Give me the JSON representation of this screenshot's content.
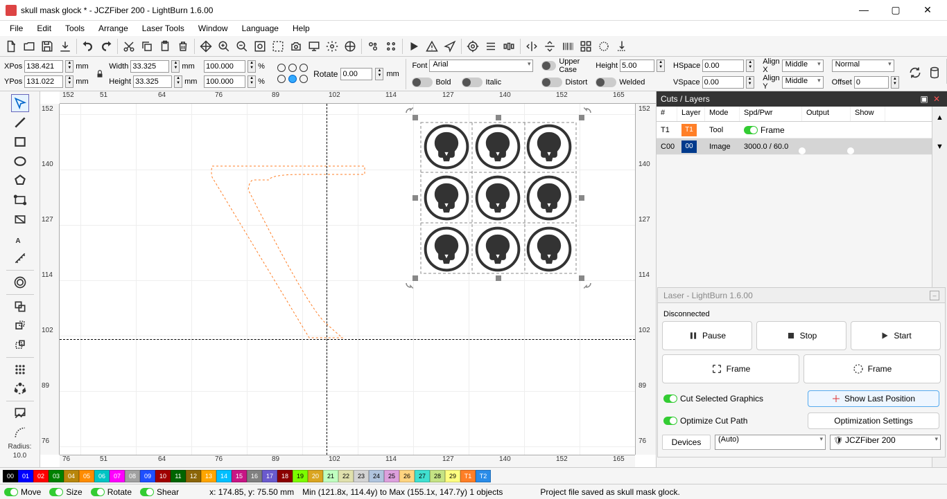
{
  "window": {
    "title": "skull mask glock * - JCZFiber 200 - LightBurn 1.6.00",
    "min": "—",
    "max": "▢",
    "close": "✕"
  },
  "menu": [
    "File",
    "Edit",
    "Tools",
    "Arrange",
    "Laser Tools",
    "Window",
    "Language",
    "Help"
  ],
  "props": {
    "xpos_label": "XPos",
    "xpos": "138.421",
    "ypos_label": "YPos",
    "ypos": "131.022",
    "width_label": "Width",
    "width": "33.325",
    "height_label": "Height",
    "height": "33.325",
    "pct1": "100.000",
    "pct2": "100.000",
    "mm": "mm",
    "pct": "%",
    "rotate_label": "Rotate",
    "rotate": "0.00"
  },
  "text_panel": {
    "font_label": "Font",
    "font": "Arial",
    "height_label": "Height",
    "height": "5.00",
    "hspace_label": "HSpace",
    "hspace": "0.00",
    "vspace_label": "VSpace",
    "vspace": "0.00",
    "alignx_label": "Align X",
    "alignx": "Middle",
    "aligny_label": "Align Y",
    "aligny": "Middle",
    "mode": "Normal",
    "offset_label": "Offset",
    "offset": "0",
    "bold": "Bold",
    "italic": "Italic",
    "upper": "Upper Case",
    "distort": "Distort",
    "welded": "Welded"
  },
  "ruler_top": [
    "152",
    "51",
    "64",
    "76",
    "89",
    "102",
    "114",
    "127",
    "140",
    "152",
    "165",
    "152"
  ],
  "ruler_left": [
    "152",
    "140",
    "127",
    "114",
    "102",
    "89",
    "76"
  ],
  "ruler_right": [
    "152",
    "140",
    "127",
    "114",
    "102",
    "89",
    "76"
  ],
  "radius_label": "Radius:",
  "radius_val": "10.0",
  "cuts": {
    "title": "Cuts / Layers",
    "cols": {
      "num": "#",
      "layer": "Layer",
      "mode": "Mode",
      "spd": "Spd/Pwr",
      "output": "Output",
      "show": "Show"
    },
    "rows": [
      {
        "num": "T1",
        "chip": "T1",
        "chip_bg": "#ff7f27",
        "mode": "Tool",
        "spd": "",
        "extra": "Frame"
      },
      {
        "num": "C00",
        "chip": "00",
        "chip_bg": "#003a8c",
        "mode": "Image",
        "spd": "3000.0 / 60.0",
        "extra": ""
      }
    ]
  },
  "laser": {
    "title": "Laser - LightBurn 1.6.00",
    "status": "Disconnected",
    "pause": "Pause",
    "stop": "Stop",
    "start": "Start",
    "frame": "Frame",
    "cutsel": "Cut Selected Graphics",
    "opt": "Optimize Cut Path",
    "showlast": "Show Last Position",
    "optset": "Optimization Settings",
    "devices": "Devices",
    "auto": "(Auto)",
    "dev": "JCZFiber 200"
  },
  "colorbar": [
    {
      "n": "00",
      "bg": "#000000",
      "fg": "#fff"
    },
    {
      "n": "01",
      "bg": "#0000ff"
    },
    {
      "n": "02",
      "bg": "#ff0000"
    },
    {
      "n": "03",
      "bg": "#008000"
    },
    {
      "n": "04",
      "bg": "#b8860b"
    },
    {
      "n": "05",
      "bg": "#ff8c00"
    },
    {
      "n": "06",
      "bg": "#00c4c4"
    },
    {
      "n": "07",
      "bg": "#ff00ff"
    },
    {
      "n": "08",
      "bg": "#a0a0a0"
    },
    {
      "n": "09",
      "bg": "#1e4fff"
    },
    {
      "n": "10",
      "bg": "#a00000"
    },
    {
      "n": "11",
      "bg": "#006400"
    },
    {
      "n": "12",
      "bg": "#8b6508"
    },
    {
      "n": "13",
      "bg": "#ffa500"
    },
    {
      "n": "14",
      "bg": "#00bfff"
    },
    {
      "n": "15",
      "bg": "#c71585"
    },
    {
      "n": "16",
      "bg": "#808080"
    },
    {
      "n": "17",
      "bg": "#6a5acd"
    },
    {
      "n": "18",
      "bg": "#8b0000"
    },
    {
      "n": "19",
      "bg": "#7cfc00",
      "fg": "#000"
    },
    {
      "n": "20",
      "bg": "#daa520"
    },
    {
      "n": "21",
      "bg": "#c0ffc0",
      "fg": "#000"
    },
    {
      "n": "22",
      "bg": "#e0e0ad",
      "fg": "#000"
    },
    {
      "n": "23",
      "bg": "#d3d3d3",
      "fg": "#000"
    },
    {
      "n": "24",
      "bg": "#b0c4de",
      "fg": "#000"
    },
    {
      "n": "25",
      "bg": "#dda0dd",
      "fg": "#000"
    },
    {
      "n": "26",
      "bg": "#ffd480",
      "fg": "#000"
    },
    {
      "n": "27",
      "bg": "#40e0d0",
      "fg": "#000"
    },
    {
      "n": "28",
      "bg": "#c5e384",
      "fg": "#000"
    },
    {
      "n": "29",
      "bg": "#ffff80",
      "fg": "#000"
    },
    {
      "n": "T1",
      "bg": "#ff7f27"
    },
    {
      "n": "T2",
      "bg": "#2a8ce8"
    }
  ],
  "status": {
    "move": "Move",
    "size": "Size",
    "rotate": "Rotate",
    "shear": "Shear",
    "coord": "x: 174.85, y: 75.50 mm",
    "range": "Min (121.8x, 114.4y) to Max (155.1x, 147.7y)  1 objects",
    "msg": "Project file saved as skull mask glock."
  }
}
